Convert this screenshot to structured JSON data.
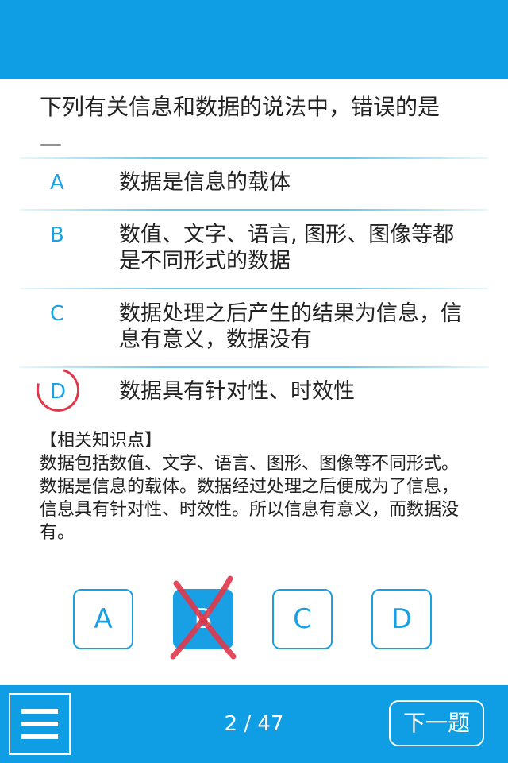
{
  "question": {
    "text": "下列有关信息和数据的说法中，错误的是",
    "blank": "—"
  },
  "options": [
    {
      "letter": "A",
      "text": "数据是信息的载体"
    },
    {
      "letter": "B",
      "text": "数值、文字、语言, 图形、图像等都是不同形式的数据"
    },
    {
      "letter": "C",
      "text": "数据处理之后产生的结果为信息，信息有意义，数据没有"
    },
    {
      "letter": "D",
      "text": "数据具有针对性、时效性"
    }
  ],
  "knowledge": {
    "title": "【相关知识点】",
    "body": "数据包括数值、文字、语言、图形、图像等不同形式。数据是信息的载体。数据经过处理之后便成为了信息，信息具有针对性、时效性。所以信息有意义，而数据没有。"
  },
  "answer_buttons": [
    "A",
    "B",
    "C",
    "D"
  ],
  "selected_answer": "B",
  "correct_answer": "D",
  "footer": {
    "page_indicator": "2 / 47",
    "next_label": "下一题"
  },
  "colors": {
    "brand_blue": "#0f9ee3",
    "mark_red": "#e0374a"
  },
  "icons": {
    "menu": "hamburger-menu-icon",
    "wrong": "x-cross-mark",
    "correct": "circle-mark"
  }
}
